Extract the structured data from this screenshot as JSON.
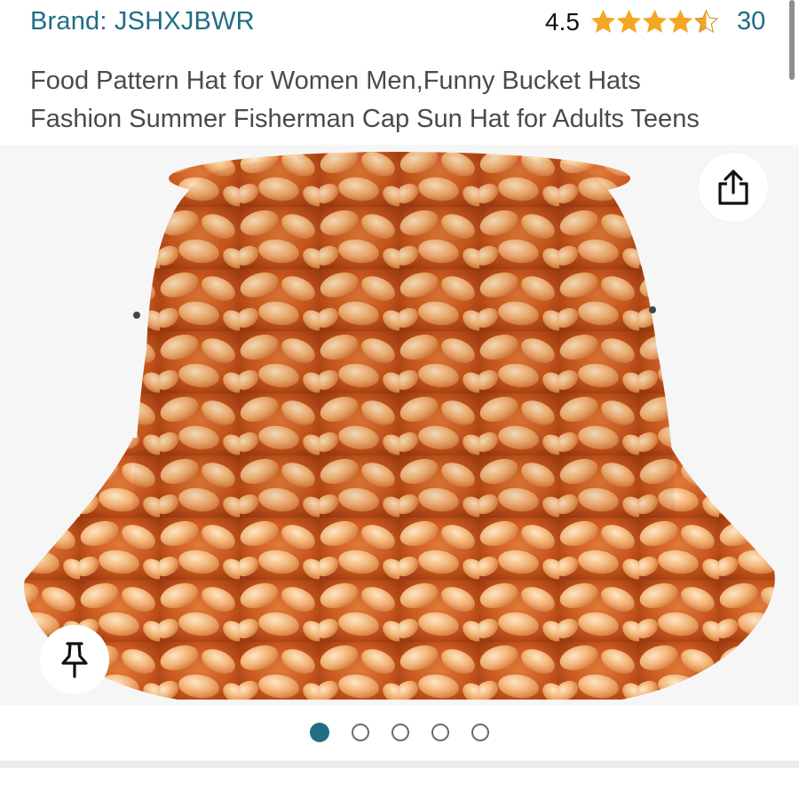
{
  "product": {
    "brand_label": "Brand: JSHXJBWR",
    "rating_value": "4.5",
    "rating_stars": 4.5,
    "review_count": "30",
    "title_lines": [
      "Food Pattern Hat for Women Men,Funny Bucket Hats",
      "Fashion Summer Fisherman Cap Sun Hat for Adults Teens"
    ]
  },
  "gallery": {
    "image_alt": "Baked beans pattern bucket hat",
    "image_count": 5,
    "active_index": 0
  },
  "icons": {
    "share": "share-icon",
    "pin": "pin-icon",
    "star": "star-icon"
  },
  "colors": {
    "link": "#1f6e86",
    "star": "#f5a623",
    "dot_active": "#1f6e86",
    "dot_inactive_border": "#6b6b6b"
  }
}
